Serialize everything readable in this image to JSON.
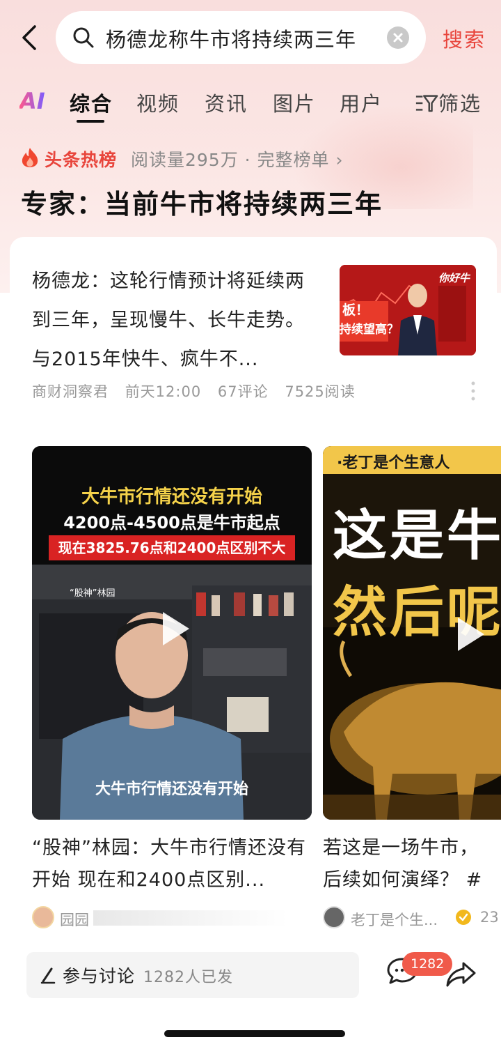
{
  "search": {
    "query": "杨德龙称牛市将持续两三年",
    "search_label": "搜索"
  },
  "tabs": {
    "ai_label": "AI",
    "items": [
      "综合",
      "视频",
      "资讯",
      "图片",
      "用户"
    ],
    "filter_label": "筛选"
  },
  "hot": {
    "label": "头条热榜",
    "meta": "阅读量295万 · 完整榜单 ›",
    "headline": "专家：当前牛市将持续两三年"
  },
  "article": {
    "text": "杨德龙：这轮行情预计将延续两到三年，呈现慢牛、长牛走势。与2015年快牛、疯牛不...",
    "thumb_text_1": "板！",
    "thumb_text_2": "持续望高？",
    "thumb_brand": "你好牛",
    "source": "商财洞察君",
    "time": "前天12:00",
    "comments": "67评论",
    "reads": "7525阅读"
  },
  "video1": {
    "title_line1": "大牛市行情还没有开始",
    "title_line2": "4200点-4500点是牛市起点",
    "title_line3": "现在3825.76点和2400点区别不大",
    "overlay_name": "“股神”林园",
    "subtitle": "大牛市行情还没有开始",
    "caption": "“股神”林园：大牛市行情还没有开始 现在和2400点区别...",
    "author": "园园"
  },
  "video2": {
    "banner": "·老丁是个生意人",
    "big_text_1": "这是牛",
    "big_text_2": "然后呢",
    "caption": "若这是一场牛市，后续如何演绎？ #牛市 #投资",
    "author": "老丁是个生...",
    "count": "23"
  },
  "bottom": {
    "discuss_label": "参与讨论",
    "discuss_count": "1282人已发",
    "comment_badge": "1282"
  },
  "colors": {
    "accent": "#e8453c",
    "badge": "#f05a4a"
  }
}
